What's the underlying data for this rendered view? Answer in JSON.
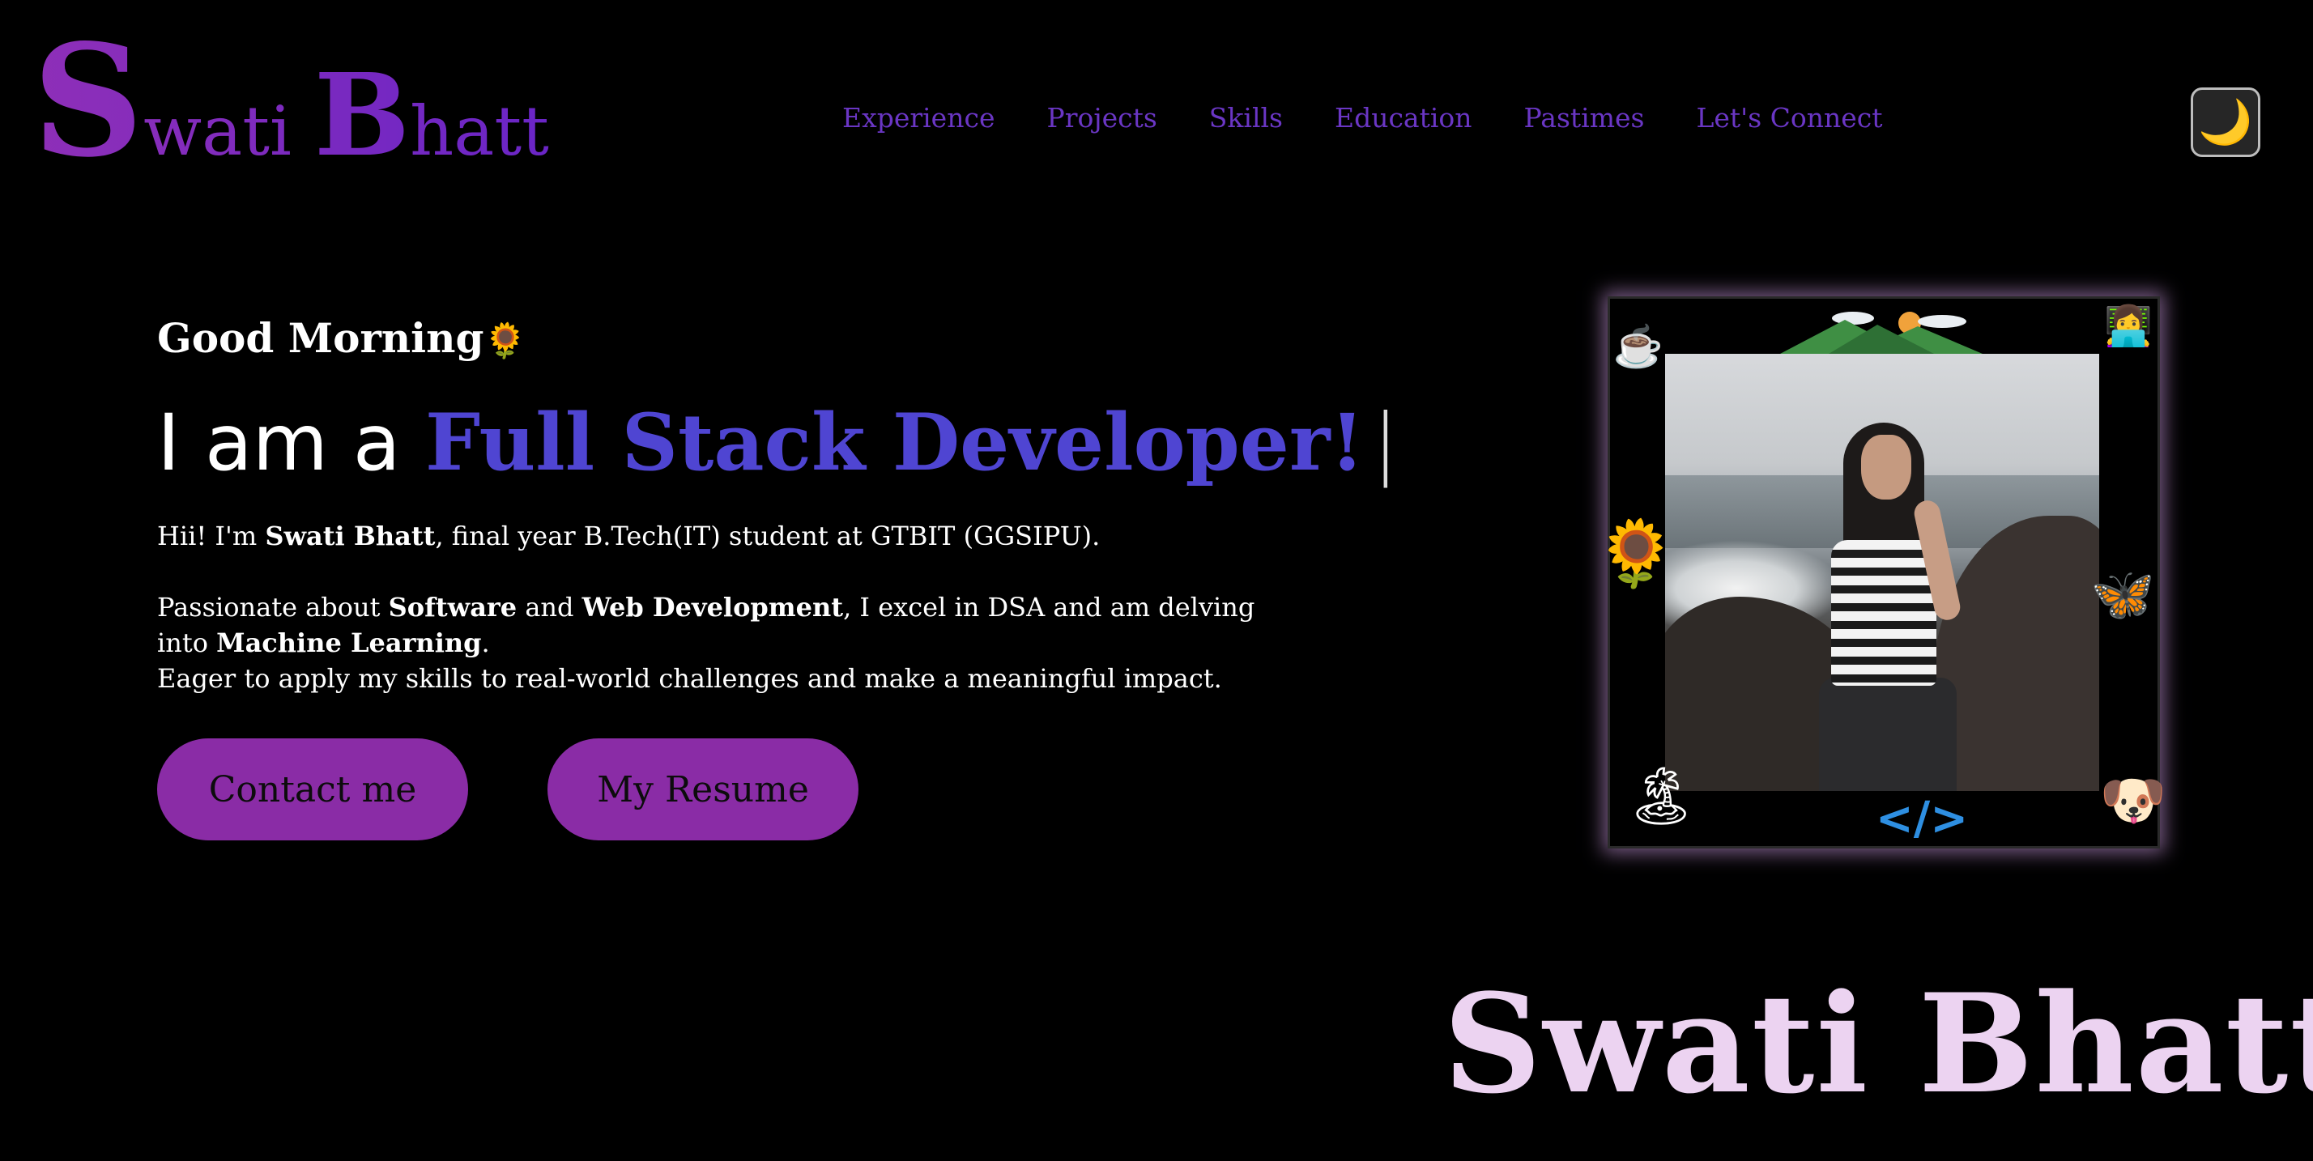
{
  "header": {
    "logo_first_initial": "S",
    "logo_first_rest": "wati",
    "logo_last_initial": "B",
    "logo_last_rest": "hatt",
    "nav": [
      "Experience",
      "Projects",
      "Skills",
      "Education",
      "Pastimes",
      "Let's Connect"
    ],
    "theme_toggle_icon": "🌙"
  },
  "hero": {
    "greeting": "Good Morning",
    "greeting_icon": "🌻",
    "headline_prefix": "I am a ",
    "headline_role": "Full Stack Developer!",
    "cursor": "|",
    "bio_line1_a": "Hii! I'm ",
    "bio_line1_name": "Swati Bhatt",
    "bio_line1_b": ", final year B.Tech(IT) student at GTBIT (GGSIPU).",
    "bio_p2_a": "Passionate about ",
    "bio_p2_software": "Software",
    "bio_p2_and": " and ",
    "bio_p2_web": "Web Development",
    "bio_p2_b": ", I excel in DSA and am delving into ",
    "bio_p2_ml": "Machine Learning",
    "bio_p2_c": ".",
    "bio_p3": "Eager to apply my skills to real-world challenges and make a meaningful impact.",
    "contact_button": "Contact me",
    "resume_button": "My Resume"
  },
  "photo_frame": {
    "icons": [
      "coffee-cup-icon",
      "mountain-icon",
      "laptop-user-icon",
      "sunflower-icon",
      "butterfly-icon",
      "travel-island-icon",
      "code-icon",
      "puppy-icon"
    ],
    "code_symbol": "</>"
  },
  "signature": "Swati Bhatt",
  "colors": {
    "background": "#000000",
    "logo": "#8e2fb8",
    "nav": "#6a36c4",
    "role": "#4f45d2",
    "button": "#8a2ca6",
    "signature": "#ecd3f1"
  }
}
